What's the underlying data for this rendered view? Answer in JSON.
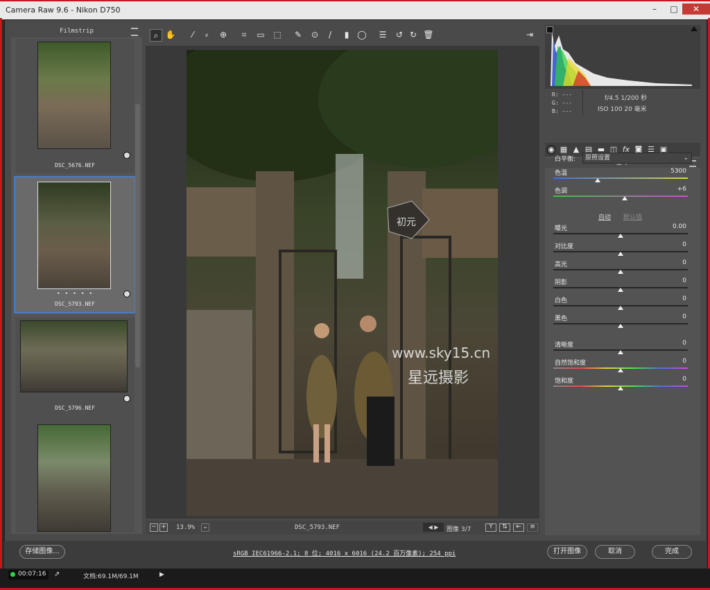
{
  "window": {
    "title": "Camera Raw 9.6 -  Nikon D750"
  },
  "filmstrip": {
    "title": "Filmstrip",
    "items": [
      {
        "name": "DSC_5676.NEF"
      },
      {
        "name": "DSC_5793.NEF",
        "dots": "• • • • •"
      },
      {
        "name": "DSC_5796.NEF"
      },
      {
        "name": ""
      }
    ]
  },
  "preview": {
    "filename": "DSC_5793.NEF",
    "zoom": "13.9%",
    "image_counter": "图像 3/7",
    "watermark_url": "www.sky15.cn",
    "watermark_cn": "星远摄影",
    "sign_text": "初元"
  },
  "camera_info": {
    "r": "R: ---",
    "g": "G: ---",
    "b": "B: ---",
    "aperture_shutter": "f/4.5  1/200 秒",
    "iso_focal": "ISO 100  20 毫米"
  },
  "panel": {
    "title": "基本",
    "white_balance_label": "白平衡:",
    "white_balance_value": "原照设置",
    "auto_label": "自动",
    "default_label": "默认值",
    "sliders": [
      {
        "label": "色温",
        "value": "5300",
        "pos": 0.33
      },
      {
        "label": "色调",
        "value": "+6",
        "pos": 0.53
      },
      {
        "label": "曝光",
        "value": "0.00",
        "pos": 0.5
      },
      {
        "label": "对比度",
        "value": "0",
        "pos": 0.5
      },
      {
        "label": "高光",
        "value": "0",
        "pos": 0.5
      },
      {
        "label": "阴影",
        "value": "0",
        "pos": 0.5
      },
      {
        "label": "白色",
        "value": "0",
        "pos": 0.5
      },
      {
        "label": "黑色",
        "value": "0",
        "pos": 0.5
      },
      {
        "label": "清晰度",
        "value": "0",
        "pos": 0.5
      },
      {
        "label": "自然饱和度",
        "value": "0",
        "pos": 0.5
      },
      {
        "label": "饱和度",
        "value": "0",
        "pos": 0.5
      }
    ]
  },
  "bottom": {
    "save_label": "存储图像...",
    "workflow_info": "sRGB IEC61966-2.1; 8 位; 4016 x 6016 (24.2 百万像素); 254 ppi",
    "open_label": "打开图像",
    "cancel_label": "取消",
    "done_label": "完成"
  },
  "status": {
    "timer": "00:07:16",
    "doc_size": "文档:69.1M/69.1M"
  },
  "colors": {
    "selection_blue": "#4a7cc9",
    "accent_red": "#c9161d"
  }
}
